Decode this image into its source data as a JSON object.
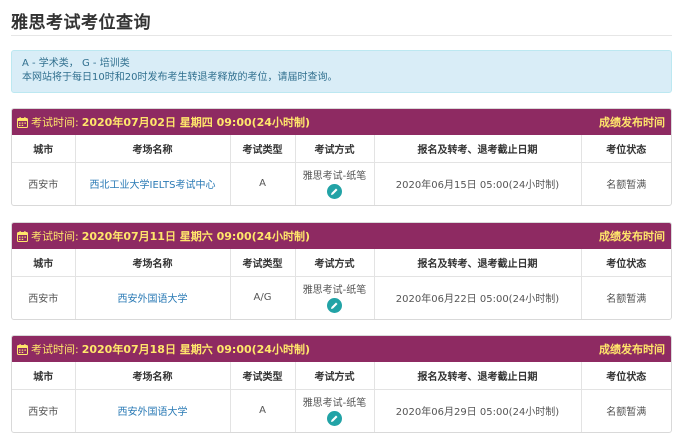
{
  "page": {
    "title": "雅思考试考位查询"
  },
  "notice": {
    "line1": "A - 学术类， G - 培训类",
    "line2": "本网站将于每日10时和20时发布考生转退考释放的考位，请届时查询。"
  },
  "table_headers": {
    "city": "城市",
    "venue": "考场名称",
    "type": "考试类型",
    "method": "考试方式",
    "deadline": "报名及转考、退考截止日期",
    "status": "考位状态"
  },
  "sessions": [
    {
      "label": "考试时间:",
      "datetime": "2020年07月02日 星期四 09:00(24小时制)",
      "result_label": "成绩发布时间",
      "city": "西安市",
      "venue": "西北工业大学IELTS考试中心",
      "type": "A",
      "method": "雅思考试-纸笔",
      "deadline": "2020年06月15日 05:00(24小时制)",
      "status": "名额暂满"
    },
    {
      "label": "考试时间:",
      "datetime": "2020年07月11日 星期六 09:00(24小时制)",
      "result_label": "成绩发布时间",
      "city": "西安市",
      "venue": "西安外国语大学",
      "type": "A/G",
      "method": "雅思考试-纸笔",
      "deadline": "2020年06月22日 05:00(24小时制)",
      "status": "名额暂满"
    },
    {
      "label": "考试时间:",
      "datetime": "2020年07月18日 星期六 09:00(24小时制)",
      "result_label": "成绩发布时间",
      "city": "西安市",
      "venue": "西安外国语大学",
      "type": "A",
      "method": "雅思考试-纸笔",
      "deadline": "2020年06月29日 05:00(24小时制)",
      "status": "名额暂满"
    }
  ],
  "icons": {
    "header": "calendar-icon",
    "method": "pencil-icon"
  },
  "colors": {
    "header_bg": "#8e2a62",
    "header_text": "#ffe66b",
    "link": "#2a7ab5",
    "notice_bg": "#d9edf7",
    "notice_text": "#31708f",
    "edit_button": "#22a3a6"
  }
}
